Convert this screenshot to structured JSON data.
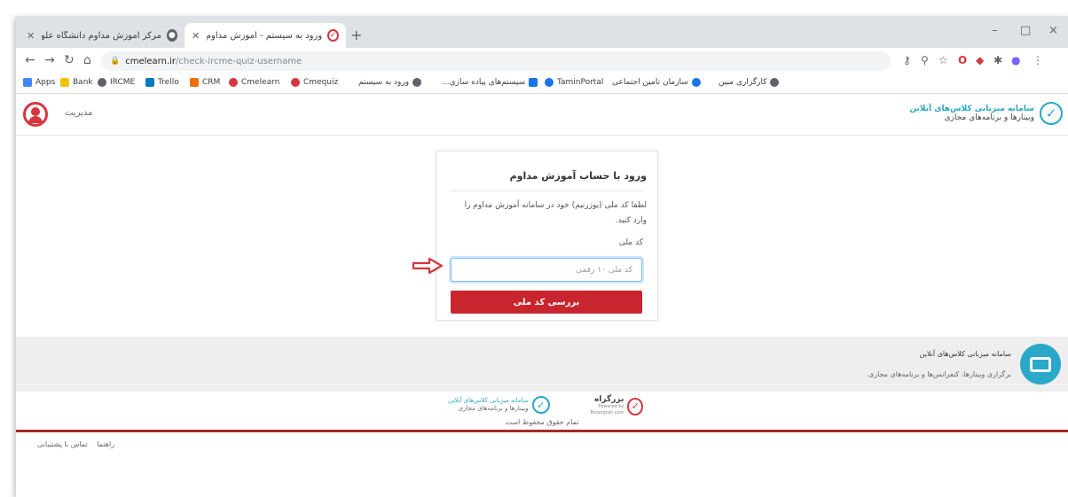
{
  "browser": {
    "tabs": [
      {
        "title": "مرکز آموزش مداوم دانشگاه علوم پ",
        "active": false
      },
      {
        "title": "ورود به سیستم - آموزش مداوم پزد",
        "active": true
      }
    ],
    "new_tab": "+",
    "url_domain": "cmelearn.ir",
    "url_path": "/check-ircme-quiz-username",
    "window_controls": {
      "minimize": "–",
      "maximize": "□",
      "close": "×"
    }
  },
  "bookmarks": [
    {
      "label": "Apps",
      "color": "#4285f4",
      "rtl": false
    },
    {
      "label": "Bank",
      "color": "#f4c20d",
      "rtl": false
    },
    {
      "label": "IRCME",
      "color": "#5f6368",
      "rtl": false
    },
    {
      "label": "Trello",
      "color": "#0079bf",
      "rtl": false
    },
    {
      "label": "CRM",
      "color": "#e8710a",
      "rtl": false
    },
    {
      "label": "Cmelearn",
      "color": "#d6363f",
      "rtl": false
    },
    {
      "label": "Cmequiz",
      "color": "#d6363f",
      "rtl": false
    },
    {
      "label": "ورود به سیستم",
      "color": "#5f6368",
      "rtl": true
    },
    {
      "label": "سیستم‌های پیاده‌ سازی...",
      "color": "#1a73e8",
      "rtl": true
    },
    {
      "label": "TaminPortal",
      "color": "#1a73e8",
      "rtl": false
    },
    {
      "label": "سازمان تامین اجتماعی",
      "color": "#1a73e8",
      "rtl": true
    },
    {
      "label": "کارگزاری مبین",
      "color": "#5f6368",
      "rtl": true
    }
  ],
  "header": {
    "admin_label": "مدیریت",
    "logo_line1": "سامانه میزبانی کلاس‌های آنلاین",
    "logo_line2": "وبینارها و برنامه‌های مجازی"
  },
  "login": {
    "title": "ورود با حساب آموزش مداوم",
    "description": "لطفا کد ملی (یوزرنیم) خود در سامانه آموزش مداوم را وارد کنید.",
    "field_label": "کد ملی",
    "field_placeholder": "کد ملی ۱۰ رقمی",
    "field_value": "",
    "submit_label": "بررسی کد ملی"
  },
  "footer": {
    "title": "سامانه میزبانی کلاس‌های آنلاین",
    "subtitle": "برگزاری وبینارها، کنفرانس‌ها و برنامه‌های مجازی",
    "partner1_line1": "سامانه میزبانی کلاس‌های آنلاین",
    "partner1_line2": "وبینارها و برنامه‌های مجازی",
    "partner2_name": "بزرگراه",
    "partner2_sub": "Powered by Bozorgrah.com",
    "copyright": "تمام حقوق محفوظ است",
    "links": [
      "راهنما",
      "تماس با پشتیبانی"
    ]
  },
  "colors": {
    "brand_red": "#c9252f",
    "brand_cyan": "#2aa7c9",
    "footer_rule": "#a52a2a"
  }
}
